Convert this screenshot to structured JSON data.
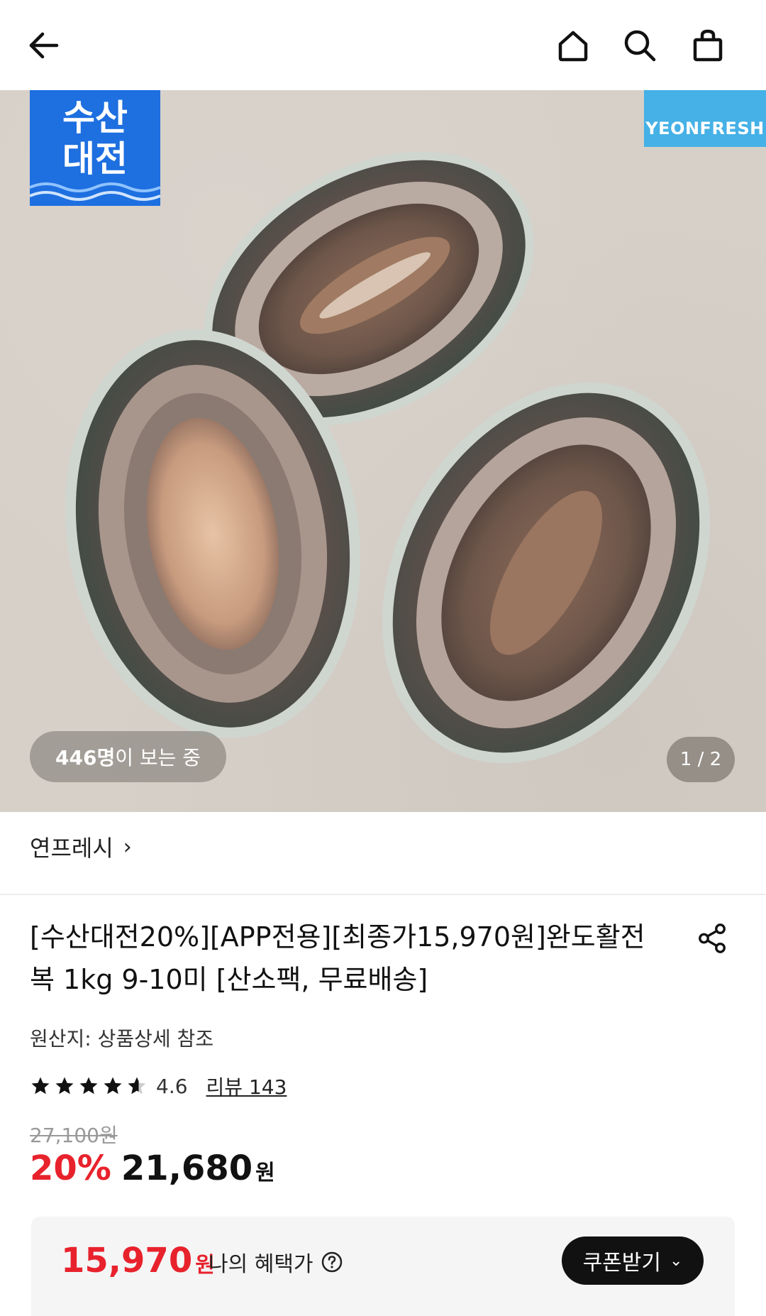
{
  "topbar": {
    "back_icon": "arrow-left-icon",
    "home_icon": "home-icon",
    "search_icon": "search-icon",
    "cart_icon": "shopping-bag-icon"
  },
  "hero": {
    "festival_badge_line1": "수산",
    "festival_badge_line2": "대전",
    "brand_badge": "YEONFRESH",
    "viewers_count": "446명",
    "viewers_suffix": "이 보는 중",
    "page_indicator": "1 / 2"
  },
  "seller": {
    "name": "연프레시",
    "chevron": "›"
  },
  "product": {
    "title": "[수산대전20%][APP전용][최종가15,970원]완도활전복 1kg 9-10미 [산소팩, 무료배송]",
    "share_icon": "share-icon",
    "origin": "원산지: 상품상세 참조",
    "rating": "4.6",
    "rating_stars": 4.6,
    "review_link": "리뷰 143",
    "original_price": "27,100원",
    "discount": "20%",
    "price": "21,680",
    "price_unit": "원"
  },
  "benefit": {
    "price": "15,970",
    "price_unit": "원",
    "label": "나의 혜택가",
    "help_icon": "question-circle-icon",
    "coupon_button": "쿠폰받기",
    "coupon_chevron": "⌄"
  },
  "colors": {
    "accent_red": "#e8222c",
    "festival_blue": "#1e6fe0",
    "brand_blue": "#45b1e6"
  }
}
